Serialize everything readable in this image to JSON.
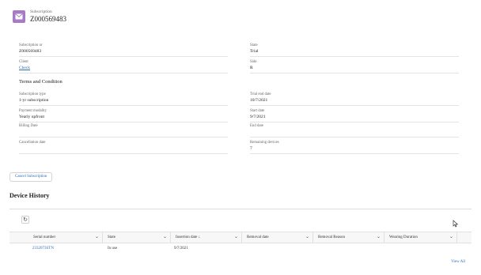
{
  "header": {
    "object_type": "Subscription",
    "object_name": "Z000569483",
    "icon": "envelope-icon"
  },
  "fields": {
    "subscription_nr": {
      "label": "Subscription nr",
      "value": "Z000569483"
    },
    "state": {
      "label": "State",
      "value": "Trial"
    },
    "client": {
      "label": "Client",
      "value": "Check"
    },
    "side": {
      "label": "Side",
      "value": "R"
    }
  },
  "terms": {
    "title": "Terms and Condition",
    "subscription_type": {
      "label": "Subscription type",
      "value": "1-yr subscription"
    },
    "trial_end_date": {
      "label": "Trial end date",
      "value": "10/7/2021"
    },
    "payment_modality": {
      "label": "Payment modality",
      "value": "Yearly upfront"
    },
    "start_date": {
      "label": "Start date",
      "value": "9/7/2021"
    },
    "billing_date": {
      "label": "Billing Date",
      "value": ""
    },
    "end_date": {
      "label": "End date",
      "value": ""
    },
    "cancellation_date": {
      "label": "Cancellation date",
      "value": ""
    },
    "remaining_devices": {
      "label": "Remaining devices",
      "value": "7"
    }
  },
  "actions": {
    "cancel_label": "Cancel Subscription"
  },
  "device_history": {
    "title": "Device History",
    "refresh_icon": "refresh-icon",
    "columns": [
      "Serial number",
      "State",
      "Insertion date",
      "Removal date",
      "Removal Reason",
      "Wearing Duration"
    ],
    "sort_indicator": "↓",
    "rows": [
      [
        "2332073STN",
        "In use",
        "9/7/2021",
        "",
        "",
        ""
      ]
    ],
    "view_all": "View All"
  }
}
